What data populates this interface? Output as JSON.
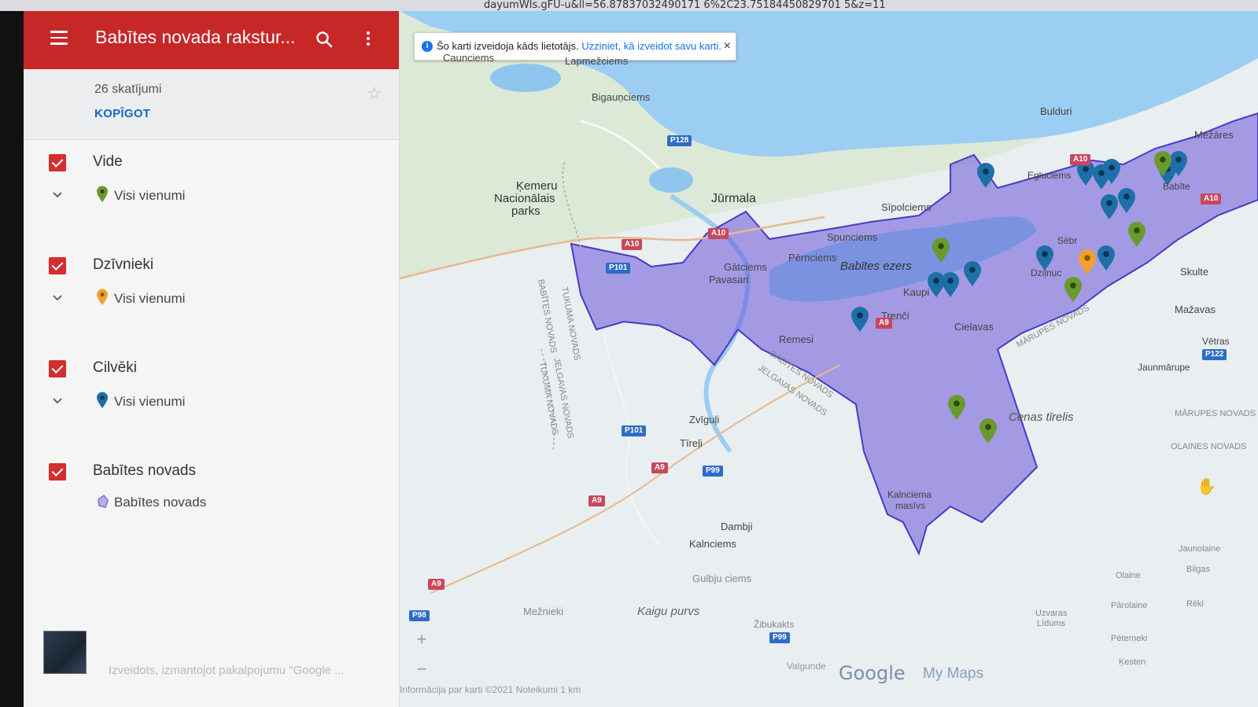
{
  "browser": {
    "url_fragment": "dayumWIs.gFU-u&ll=56.87837032490171 6%2C23.75184450829701 5&z=11"
  },
  "panel": {
    "title": "Babītes novada rakstur...",
    "views": "26 skatījumi",
    "share_label": "KOPĪGOT",
    "layers": [
      {
        "name": "Vide",
        "item_label": "Visi vienumi",
        "pin_color": "#6a9a2e"
      },
      {
        "name": "Dzīvnieki",
        "item_label": "Visi vienumi",
        "pin_color": "#f0a030"
      },
      {
        "name": "Cilvēki",
        "item_label": "Visi vienumi",
        "pin_color": "#1e6fa8"
      },
      {
        "name": "Babītes novads",
        "item_label": "Babītes novads",
        "pin_color": "#8a7fd6"
      }
    ],
    "footer": "Izveidots, izmantojot pakalpojumu \"Google ..."
  },
  "banner": {
    "text": "Šo karti izveidoja kāds lietotājs.",
    "link": "Uzziniet, kā izveidot savu karti.",
    "close": "×"
  },
  "map": {
    "labels": {
      "caunciems": "Caunciems",
      "lapmezciems": "Lapmežciems",
      "bigaunciems": "Bigauņciems",
      "bulduri": "Bulduri",
      "mezares": "Mežāres",
      "kemeri_1": "Ķemeru",
      "kemeri_2": "Nacionālais",
      "kemeri_3": "parks",
      "jurmala": "Jūrmala",
      "egluciems": "Egluciems",
      "sipolciems": "Sīpolciems",
      "spunciems": "Spunciems",
      "babite": "Babīte",
      "gatciems": "Gātciems",
      "pavasari": "Pavasari",
      "perniciems": "Pērnciems",
      "babites_ezers": "Babītes ezers",
      "sebr": "Sēbr",
      "dzilnuc": "Dziļnuc",
      "kaupi": "Kaupi",
      "skulte": "Skulte",
      "mazavas": "Mažavas",
      "trenci": "Trenči",
      "cielavas": "Cielavas",
      "remesi": "Remesi",
      "vetras": "Vētras",
      "jaunmarupe": "Jaunmārupe",
      "zviguli": "Zvīguļi",
      "tireli": "Tīreļi",
      "cenas_tirelis": "Cenas tīrelis",
      "dambji": "Dambji",
      "kalnciems": "Kalnciems",
      "kalnciema_masivs_1": "Kalnciema",
      "kalnciema_masivs_2": "masīvs",
      "gulbju_ciems": "Gulbju ciems",
      "meznieki": "Mežnieki",
      "kaigu_purvs": "Kaigu purvs",
      "zibukakts": "Žibukakts",
      "valgunde": "Valgunde",
      "olaine": "Olaine",
      "jaunolaine": "Jaunolaine",
      "bilgas": "Bilgas",
      "parolaine": "Pārolaine",
      "reki": "Rēki",
      "uzvaras_1": "Uzvaras",
      "uzvaras_2": "Līdums",
      "peterneki": "Pēterņeki",
      "kesten": "Ķesten",
      "babites_novads_v": "BABĪTES NOVADS",
      "tukuma_novads_v": "TUKUMA NOVADS",
      "babites_novads_d": "BABĪTES NOVADS",
      "jelgavas_novads_d": "JELGAVAS NOVADS",
      "marupes_novads_d": "MĀRUPES NOVADS",
      "jelgavas_tukuma_1": "JELGAVAS NOVADS",
      "jelgavas_tukuma_2": "TUKUMA NOVADS",
      "marupes_novads_r": "MĀRUPES NOVADS",
      "olaines_novads_r": "OLAINES NOVADS"
    },
    "roads": {
      "p128": "P128",
      "a10a": "A10",
      "a10b": "A10",
      "a10c": "A10",
      "a10d": "A10",
      "p101a": "P101",
      "p101b": "P101",
      "a9a": "A9",
      "a9b": "A9",
      "a9c": "A9",
      "a9d": "A9",
      "p99a": "P99",
      "p99b": "P99",
      "p98": "P98",
      "p122": "P122"
    },
    "zoom_in": "+",
    "zoom_out": "−",
    "logo": "Google",
    "logo_suffix": "My Maps",
    "attribution": "Informācija par karti ©2021   Noteikumi   1 km"
  },
  "colors": {
    "header": "#c62828",
    "checkbox": "#d32f2f",
    "share": "#1a66c9",
    "region_fill": "#6a55d8",
    "pin_environment": "#6a9a2e",
    "pin_animals": "#f0a030",
    "pin_people": "#1e6fa8"
  }
}
